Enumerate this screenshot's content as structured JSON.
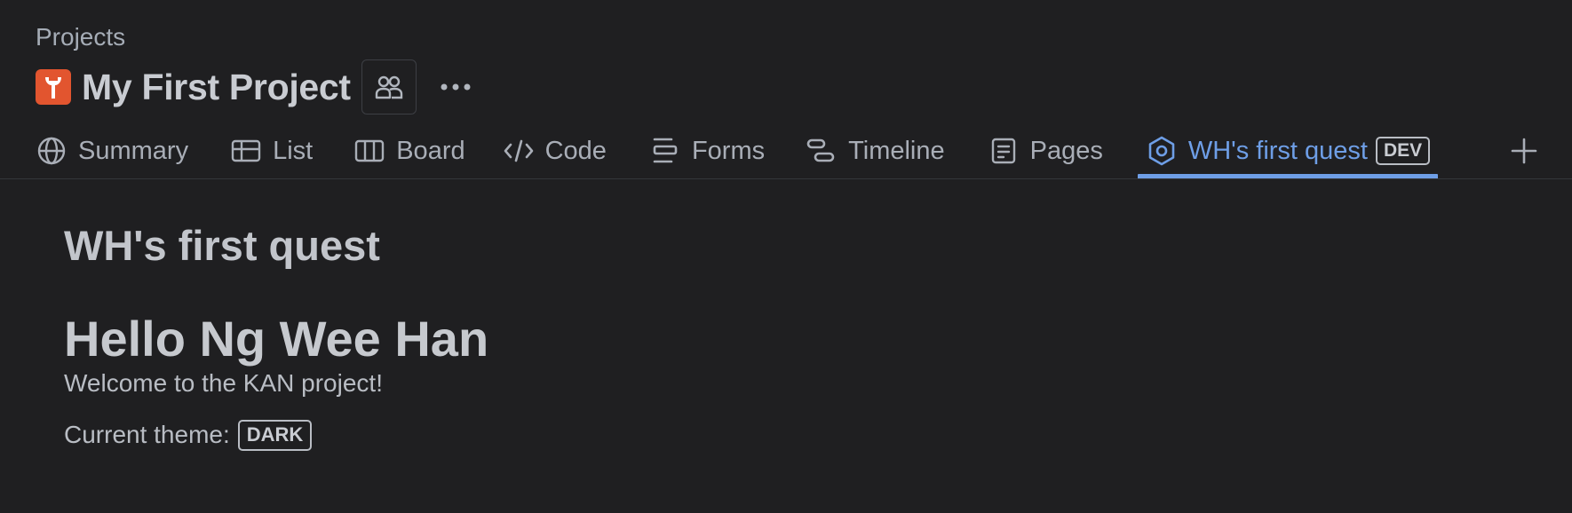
{
  "breadcrumb": "Projects",
  "project": {
    "title": "My First Project",
    "icon": "wrench-project-icon",
    "icon_color": "#e2552f"
  },
  "tabs": [
    {
      "label": "Summary",
      "icon": "globe-icon"
    },
    {
      "label": "List",
      "icon": "list-table-icon"
    },
    {
      "label": "Board",
      "icon": "board-columns-icon"
    },
    {
      "label": "Code",
      "icon": "code-icon"
    },
    {
      "label": "Forms",
      "icon": "forms-icon"
    },
    {
      "label": "Timeline",
      "icon": "timeline-icon"
    },
    {
      "label": "Pages",
      "icon": "pages-icon"
    },
    {
      "label": "WH's first quest",
      "icon": "hexagon-app-icon",
      "badge": "DEV",
      "active": true
    }
  ],
  "colors": {
    "background": "#1f1f21",
    "accent": "#6e9ee6",
    "text": "#b6bbc3"
  },
  "main": {
    "heading": "WH's first quest",
    "greeting": "Hello Ng Wee Han",
    "welcome": "Welcome to the KAN project!",
    "theme_label": "Current theme:",
    "theme_value": "DARK"
  }
}
